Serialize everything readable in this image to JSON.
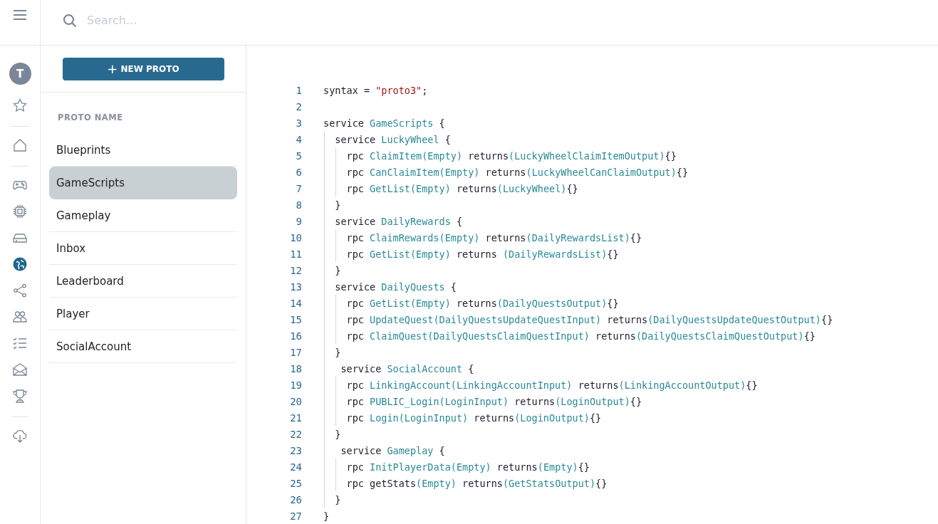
{
  "search": {
    "placeholder": "Search..."
  },
  "avatar": {
    "initial": "T"
  },
  "nav_rail": [
    {
      "kind": "star",
      "selected": false
    },
    {
      "kind": "divider"
    },
    {
      "kind": "home",
      "selected": false
    },
    {
      "kind": "divider"
    },
    {
      "kind": "gamepad",
      "selected": false
    },
    {
      "kind": "chip",
      "selected": false
    },
    {
      "kind": "drive",
      "selected": false
    },
    {
      "kind": "globe",
      "selected": true
    },
    {
      "kind": "share",
      "selected": false
    },
    {
      "kind": "people",
      "selected": false
    },
    {
      "kind": "checklist",
      "selected": false
    },
    {
      "kind": "mail",
      "selected": false
    },
    {
      "kind": "trophy",
      "selected": false
    },
    {
      "kind": "divider"
    },
    {
      "kind": "cloud-download",
      "selected": false
    }
  ],
  "new_button": {
    "icon": "+",
    "label": "NEW PROTO"
  },
  "proto_list": {
    "heading": "PROTO NAME",
    "items": [
      {
        "label": "Blueprints",
        "selected": false
      },
      {
        "label": "GameScripts",
        "selected": true
      },
      {
        "label": "Gameplay",
        "selected": false
      },
      {
        "label": "Inbox",
        "selected": false
      },
      {
        "label": "Leaderboard",
        "selected": false
      },
      {
        "label": "Player",
        "selected": false
      },
      {
        "label": "SocialAccount",
        "selected": false
      }
    ]
  },
  "code": {
    "lines": [
      {
        "number": "1",
        "tokens": [
          {
            "kind": "plain",
            "text": "syntax = "
          },
          {
            "kind": "string",
            "text": "\"proto3\""
          },
          {
            "kind": "plain",
            "text": ";"
          }
        ]
      },
      {
        "number": "2"
      },
      {
        "number": "3",
        "tokens": [
          {
            "kind": "plain",
            "text": "service "
          },
          {
            "kind": "type",
            "text": "GameScripts"
          },
          {
            "kind": "plain",
            "text": " {"
          }
        ]
      },
      {
        "number": "4",
        "tokens": [
          {
            "kind": "plain",
            "text": "  service "
          },
          {
            "kind": "type",
            "text": "LuckyWheel"
          },
          {
            "kind": "plain",
            "text": " {"
          }
        ]
      },
      {
        "number": "5",
        "tokens": [
          {
            "kind": "plain",
            "text": "    rpc "
          },
          {
            "kind": "type",
            "text": "ClaimItem(Empty)"
          },
          {
            "kind": "plain",
            "text": " returns"
          },
          {
            "kind": "type",
            "text": "(LuckyWheelClaimItemOutput)"
          },
          {
            "kind": "plain",
            "text": "{}"
          }
        ]
      },
      {
        "number": "6",
        "tokens": [
          {
            "kind": "plain",
            "text": "    rpc "
          },
          {
            "kind": "type",
            "text": "CanClaimItem(Empty)"
          },
          {
            "kind": "plain",
            "text": " returns"
          },
          {
            "kind": "type",
            "text": "(LuckyWheelCanClaimOutput)"
          },
          {
            "kind": "plain",
            "text": "{}"
          }
        ]
      },
      {
        "number": "7",
        "tokens": [
          {
            "kind": "plain",
            "text": "    rpc "
          },
          {
            "kind": "type",
            "text": "GetList(Empty)"
          },
          {
            "kind": "plain",
            "text": " returns"
          },
          {
            "kind": "type",
            "text": "(LuckyWheel)"
          },
          {
            "kind": "plain",
            "text": "{}"
          }
        ]
      },
      {
        "number": "8",
        "tokens": [
          {
            "kind": "plain",
            "text": "  }"
          }
        ]
      },
      {
        "number": "9",
        "tokens": [
          {
            "kind": "plain",
            "text": "  service "
          },
          {
            "kind": "type",
            "text": "DailyRewards"
          },
          {
            "kind": "plain",
            "text": " {"
          }
        ]
      },
      {
        "number": "10",
        "tokens": [
          {
            "kind": "plain",
            "text": "    rpc "
          },
          {
            "kind": "type",
            "text": "ClaimRewards(Empty)"
          },
          {
            "kind": "plain",
            "text": " returns"
          },
          {
            "kind": "type",
            "text": "(DailyRewardsList)"
          },
          {
            "kind": "plain",
            "text": "{}"
          }
        ]
      },
      {
        "number": "11",
        "tokens": [
          {
            "kind": "plain",
            "text": "    rpc "
          },
          {
            "kind": "type",
            "text": "GetList(Empty)"
          },
          {
            "kind": "plain",
            "text": " returns "
          },
          {
            "kind": "type",
            "text": "(DailyRewardsList)"
          },
          {
            "kind": "plain",
            "text": "{}"
          }
        ]
      },
      {
        "number": "12",
        "tokens": [
          {
            "kind": "plain",
            "text": "  }"
          }
        ]
      },
      {
        "number": "13",
        "tokens": [
          {
            "kind": "plain",
            "text": "  service "
          },
          {
            "kind": "type",
            "text": "DailyQuests"
          },
          {
            "kind": "plain",
            "text": " {"
          }
        ]
      },
      {
        "number": "14",
        "tokens": [
          {
            "kind": "plain",
            "text": "    rpc "
          },
          {
            "kind": "type",
            "text": "GetList(Empty)"
          },
          {
            "kind": "plain",
            "text": " returns"
          },
          {
            "kind": "type",
            "text": "(DailyQuestsOutput)"
          },
          {
            "kind": "plain",
            "text": "{}"
          }
        ]
      },
      {
        "number": "15",
        "tokens": [
          {
            "kind": "plain",
            "text": "    rpc "
          },
          {
            "kind": "type",
            "text": "UpdateQuest(DailyQuestsUpdateQuestInput)"
          },
          {
            "kind": "plain",
            "text": " returns"
          },
          {
            "kind": "type",
            "text": "(DailyQuestsUpdateQuestOutput)"
          },
          {
            "kind": "plain",
            "text": "{}"
          }
        ]
      },
      {
        "number": "16",
        "tokens": [
          {
            "kind": "plain",
            "text": "    rpc "
          },
          {
            "kind": "type",
            "text": "ClaimQuest(DailyQuestsClaimQuestInput)"
          },
          {
            "kind": "plain",
            "text": " returns"
          },
          {
            "kind": "type",
            "text": "(DailyQuestsClaimQuestOutput)"
          },
          {
            "kind": "plain",
            "text": "{}"
          }
        ]
      },
      {
        "number": "17",
        "tokens": [
          {
            "kind": "plain",
            "text": "  }"
          }
        ]
      },
      {
        "number": "18",
        "tokens": [
          {
            "kind": "plain",
            "text": "   service "
          },
          {
            "kind": "type",
            "text": "SocialAccount"
          },
          {
            "kind": "plain",
            "text": " {"
          }
        ]
      },
      {
        "number": "19",
        "tokens": [
          {
            "kind": "plain",
            "text": "    rpc "
          },
          {
            "kind": "type",
            "text": "LinkingAccount(LinkingAccountInput)"
          },
          {
            "kind": "plain",
            "text": " returns"
          },
          {
            "kind": "type",
            "text": "(LinkingAccountOutput)"
          },
          {
            "kind": "plain",
            "text": "{}"
          }
        ]
      },
      {
        "number": "20",
        "tokens": [
          {
            "kind": "plain",
            "text": "    rpc "
          },
          {
            "kind": "type",
            "text": "PUBLIC_Login(LoginInput)"
          },
          {
            "kind": "plain",
            "text": " returns"
          },
          {
            "kind": "type",
            "text": "(LoginOutput)"
          },
          {
            "kind": "plain",
            "text": "{}"
          }
        ]
      },
      {
        "number": "21",
        "tokens": [
          {
            "kind": "plain",
            "text": "    rpc "
          },
          {
            "kind": "type",
            "text": "Login(LoginInput)"
          },
          {
            "kind": "plain",
            "text": " returns"
          },
          {
            "kind": "type",
            "text": "(LoginOutput)"
          },
          {
            "kind": "plain",
            "text": "{}"
          }
        ]
      },
      {
        "number": "22",
        "tokens": [
          {
            "kind": "plain",
            "text": "  }"
          }
        ]
      },
      {
        "number": "23",
        "tokens": [
          {
            "kind": "plain",
            "text": "   service "
          },
          {
            "kind": "type",
            "text": "Gameplay"
          },
          {
            "kind": "plain",
            "text": " {"
          }
        ]
      },
      {
        "number": "24",
        "tokens": [
          {
            "kind": "plain",
            "text": "    rpc "
          },
          {
            "kind": "type",
            "text": "InitPlayerData(Empty)"
          },
          {
            "kind": "plain",
            "text": " returns"
          },
          {
            "kind": "type",
            "text": "(Empty)"
          },
          {
            "kind": "plain",
            "text": "{}"
          }
        ]
      },
      {
        "number": "25",
        "tokens": [
          {
            "kind": "plain",
            "text": "    rpc getStats"
          },
          {
            "kind": "type",
            "text": "(Empty)"
          },
          {
            "kind": "plain",
            "text": " returns"
          },
          {
            "kind": "type",
            "text": "(GetStatsOutput)"
          },
          {
            "kind": "plain",
            "text": "{}"
          }
        ]
      },
      {
        "number": "26",
        "tokens": [
          {
            "kind": "plain",
            "text": "  }"
          }
        ]
      },
      {
        "number": "27",
        "tokens": [
          {
            "kind": "plain",
            "text": "}"
          }
        ]
      }
    ]
  }
}
